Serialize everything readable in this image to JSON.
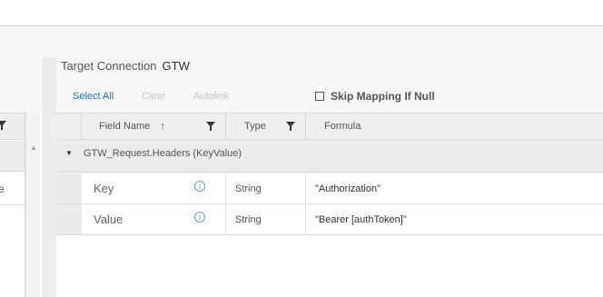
{
  "left_panel": {
    "row_value_fragment": "e"
  },
  "target": {
    "label": "Target Connection",
    "connection": "GTW"
  },
  "actions": {
    "select_all": "Select All",
    "clear": "Clear",
    "autolink": "Autolink"
  },
  "skip_mapping": {
    "label": "Skip Mapping If Null",
    "checked": false
  },
  "grid": {
    "columns": {
      "field_name": "Field Name",
      "sort_arrow": "↑",
      "type": "Type",
      "formula": "Formula"
    },
    "group": {
      "caret": "▼",
      "label": "GTW_Request.Headers (KeyValue)"
    },
    "rows": [
      {
        "field": "Key",
        "info_glyph": "i",
        "type": "String",
        "formula": "\"Authorization\""
      },
      {
        "field": "Value",
        "info_glyph": "i",
        "type": "String",
        "formula": "\"Bearer [authToken]\""
      }
    ]
  },
  "icons": {
    "filter": "funnel-icon",
    "info": "info-icon",
    "scroll_up": "scroll-up-arrow-icon",
    "expand": "caret-down-icon"
  },
  "colors": {
    "link": "#1f6fbf",
    "disabled": "#c8c8c8",
    "info": "#5aa0d8",
    "header_bg": "#efefef"
  }
}
